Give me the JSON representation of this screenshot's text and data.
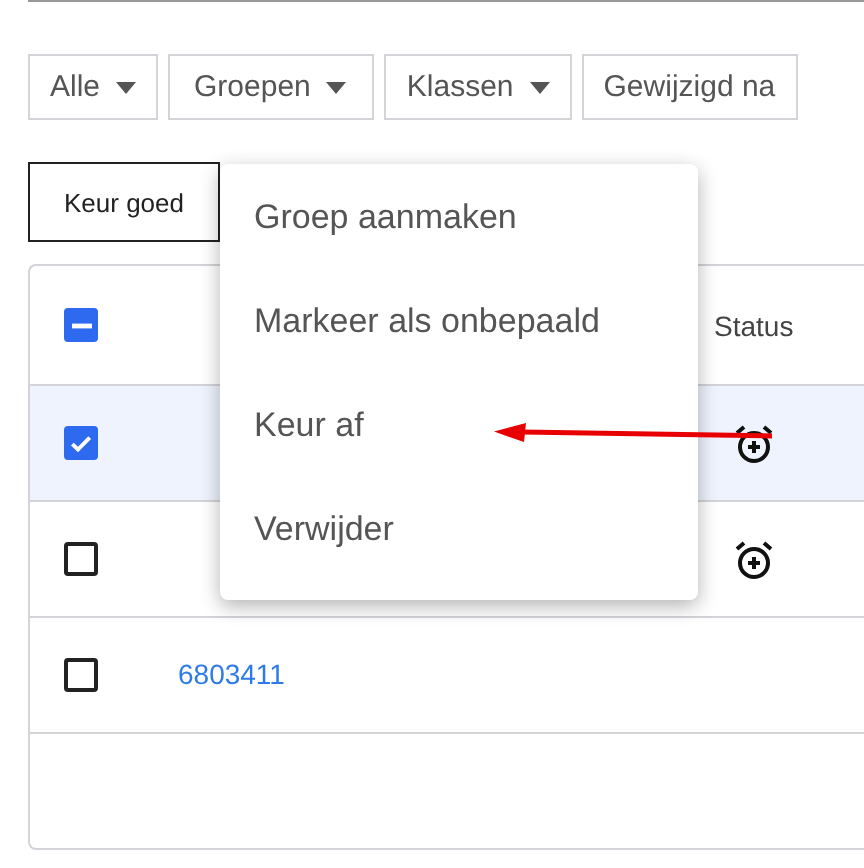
{
  "filters": [
    {
      "label": "Alle"
    },
    {
      "label": "Groepen"
    },
    {
      "label": "Klassen"
    },
    {
      "label": "Gewijzigd na"
    }
  ],
  "bulk_button": {
    "label": "Keur goed"
  },
  "menu": {
    "items": [
      {
        "label": "Groep aanmaken"
      },
      {
        "label": "Markeer als onbepaald"
      },
      {
        "label": "Keur af"
      },
      {
        "label": "Verwijder"
      }
    ]
  },
  "table": {
    "header_checkbox": {
      "indeterminate": true
    },
    "columns": [
      "Status"
    ],
    "rows": [
      {
        "checked": true,
        "status_alarm": true
      },
      {
        "checked": false,
        "status_alarm": true
      },
      {
        "checked": false,
        "number": "6803411",
        "status_alarm": false
      }
    ]
  }
}
